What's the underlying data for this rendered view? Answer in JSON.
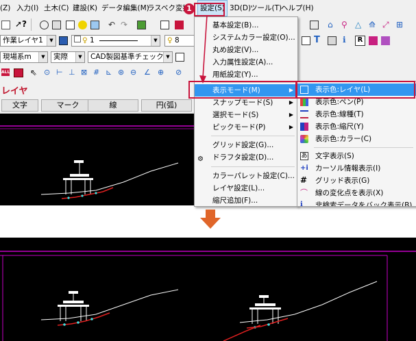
{
  "menubar": {
    "items": [
      "(Z)",
      "入力(I)",
      "土木(C)",
      "建設(K)",
      "データ編集(M)",
      "ラスベク変換",
      "設定(S)",
      "3D(D)",
      "ツール(T)",
      "ヘルプ(H)"
    ]
  },
  "step_badge": "1",
  "toolbar2": {
    "layer_combo": "作業レイヤ1",
    "line_combo": "1",
    "color_combo": "8"
  },
  "toolbar3": {
    "coord_combo": "現場系m",
    "scale_combo": "実際",
    "check_combo": "CAD製図基準チェック"
  },
  "panel": {
    "title": "レイヤ",
    "buttons": [
      "文字",
      "マーク",
      "線",
      "円(弧)"
    ]
  },
  "settings_menu": {
    "items": [
      "基本設定(B)...",
      "システムカラー設定(O)...",
      "丸め設定(V)...",
      "入力属性設定(A)...",
      "用紙設定(Y)...",
      "表示モード(M)",
      "スナップモード(S)",
      "選択モード(S)",
      "ピックモード(P)",
      "グリッド設定(G)...",
      "ドラフタ設定(D)...",
      "カラーパレット設定(C)...",
      "レイヤ設定(L)...",
      "縮尺追加(F)..."
    ]
  },
  "display_submenu": {
    "items": [
      "表示色:レイヤ(L)",
      "表示色:ペン(P)",
      "表示色:線種(T)",
      "表示色:縮尺(Y)",
      "表示色:カラー(C)",
      "文字表示(S)",
      "カーソル情報表示(I)",
      "グリッド表示(G)",
      "線の変化点を表示(X)",
      "非検索データをバック表示(B)"
    ]
  },
  "colors": {
    "highlight": "#3296f0",
    "callout": "#c8143c",
    "arrow": "#e0662a",
    "panel_title": "#c0142c",
    "frame": "#c800c8"
  }
}
